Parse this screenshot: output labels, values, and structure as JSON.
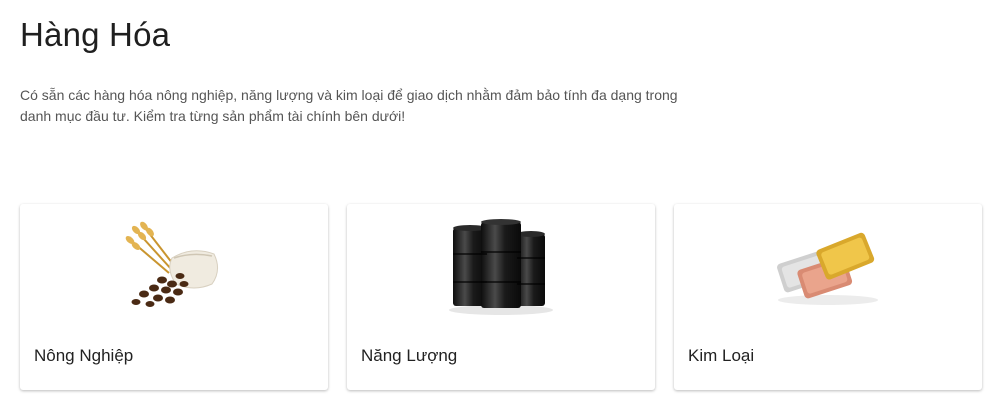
{
  "page": {
    "title": "Hàng Hóa",
    "intro": "Có sẵn các hàng hóa nông nghiệp, năng lượng và kim loại để giao dịch nhằm đảm bảo tính đa dạng trong danh mục đầu tư. Kiểm tra từng sản phẩm tài chính bên dưới!"
  },
  "cards": [
    {
      "label": "Nông Nghiệp",
      "icon": "wheat-coffee-sack-icon"
    },
    {
      "label": "Năng Lượng",
      "icon": "oil-barrels-icon"
    },
    {
      "label": "Kim Loại",
      "icon": "metal-bars-icon"
    }
  ],
  "colors": {
    "title": "#1f1f1f",
    "body_text": "#555555",
    "gold": "#e0b53a",
    "copper": "#d98b73",
    "silver": "#c9c9c9",
    "barrel": "#1e1e1e"
  }
}
